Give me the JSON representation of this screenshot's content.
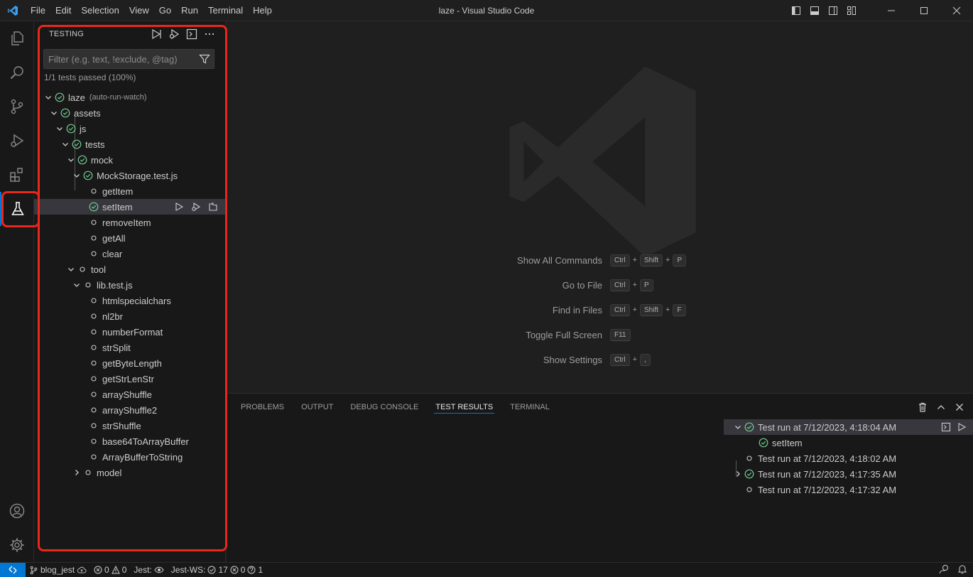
{
  "window": {
    "title": "laze - Visual Studio Code",
    "menu": [
      "File",
      "Edit",
      "Selection",
      "View",
      "Go",
      "Run",
      "Terminal",
      "Help"
    ]
  },
  "sidebar": {
    "title": "TESTING",
    "filter_placeholder": "Filter (e.g. text, !exclude, @tag)",
    "summary": "1/1 tests passed (100%)",
    "tree": [
      {
        "label": "laze",
        "desc": "(auto-run-watch)",
        "depth": 0,
        "chevron": "down",
        "status": "passed"
      },
      {
        "label": "assets",
        "depth": 1,
        "chevron": "down",
        "status": "passed"
      },
      {
        "label": "js",
        "depth": 2,
        "chevron": "down",
        "status": "passed"
      },
      {
        "label": "tests",
        "depth": 3,
        "chevron": "down",
        "status": "passed"
      },
      {
        "label": "mock",
        "depth": 4,
        "chevron": "down",
        "status": "passed"
      },
      {
        "label": "MockStorage.test.js",
        "depth": 5,
        "chevron": "down",
        "status": "passed"
      },
      {
        "label": "getItem",
        "depth": 6,
        "chevron": "none",
        "status": "unset"
      },
      {
        "label": "setItem",
        "depth": 6,
        "chevron": "none",
        "status": "passed",
        "selected": true
      },
      {
        "label": "removeItem",
        "depth": 6,
        "chevron": "none",
        "status": "unset"
      },
      {
        "label": "getAll",
        "depth": 6,
        "chevron": "none",
        "status": "unset"
      },
      {
        "label": "clear",
        "depth": 6,
        "chevron": "none",
        "status": "unset"
      },
      {
        "label": "tool",
        "depth": 4,
        "chevron": "down",
        "status": "unset"
      },
      {
        "label": "lib.test.js",
        "depth": 5,
        "chevron": "down",
        "status": "unset"
      },
      {
        "label": "htmlspecialchars",
        "depth": 6,
        "chevron": "none",
        "status": "unset"
      },
      {
        "label": "nl2br",
        "depth": 6,
        "chevron": "none",
        "status": "unset"
      },
      {
        "label": "numberFormat",
        "depth": 6,
        "chevron": "none",
        "status": "unset"
      },
      {
        "label": "strSplit",
        "depth": 6,
        "chevron": "none",
        "status": "unset"
      },
      {
        "label": "getByteLength",
        "depth": 6,
        "chevron": "none",
        "status": "unset"
      },
      {
        "label": "getStrLenStr",
        "depth": 6,
        "chevron": "none",
        "status": "unset"
      },
      {
        "label": "arrayShuffle",
        "depth": 6,
        "chevron": "none",
        "status": "unset"
      },
      {
        "label": "arrayShuffle2",
        "depth": 6,
        "chevron": "none",
        "status": "unset"
      },
      {
        "label": "strShuffle",
        "depth": 6,
        "chevron": "none",
        "status": "unset"
      },
      {
        "label": "base64ToArrayBuffer",
        "depth": 6,
        "chevron": "none",
        "status": "unset"
      },
      {
        "label": "ArrayBufferToString",
        "depth": 6,
        "chevron": "none",
        "status": "unset"
      },
      {
        "label": "model",
        "depth": 5,
        "chevron": "right",
        "status": "unset"
      }
    ]
  },
  "editor": {
    "shortcuts": [
      {
        "label": "Show All Commands",
        "keys": [
          "Ctrl",
          "Shift",
          "P"
        ]
      },
      {
        "label": "Go to File",
        "keys": [
          "Ctrl",
          "P"
        ]
      },
      {
        "label": "Find in Files",
        "keys": [
          "Ctrl",
          "Shift",
          "F"
        ]
      },
      {
        "label": "Toggle Full Screen",
        "keys": [
          "F11"
        ]
      },
      {
        "label": "Show Settings",
        "keys": [
          "Ctrl",
          ","
        ]
      }
    ]
  },
  "panel": {
    "tabs": [
      "PROBLEMS",
      "OUTPUT",
      "DEBUG CONSOLE",
      "TEST RESULTS",
      "TERMINAL"
    ],
    "active_tab": "TEST RESULTS",
    "runs": [
      {
        "label": "Test run at 7/12/2023, 4:18:04 AM",
        "depth": 0,
        "chevron": "down",
        "status": "passed",
        "selected": true
      },
      {
        "label": "setItem",
        "depth": 1,
        "chevron": "none",
        "status": "passed"
      },
      {
        "label": "Test run at 7/12/2023, 4:18:02 AM",
        "depth": 0,
        "chevron": "none",
        "status": "unset"
      },
      {
        "label": "Test run at 7/12/2023, 4:17:35 AM",
        "depth": 0,
        "chevron": "right",
        "status": "passed"
      },
      {
        "label": "Test run at 7/12/2023, 4:17:32 AM",
        "depth": 0,
        "chevron": "none",
        "status": "unset"
      }
    ]
  },
  "statusbar": {
    "branch": "blog_jest",
    "errors": "0",
    "warnings": "0",
    "jest_label": "Jest:",
    "jest_ws_label": "Jest-WS:",
    "passed": "17",
    "failed": "0",
    "unknown": "1"
  },
  "colors": {
    "accent": "#0078d4",
    "passed": "#73c991",
    "highlight": "#e8271d"
  }
}
